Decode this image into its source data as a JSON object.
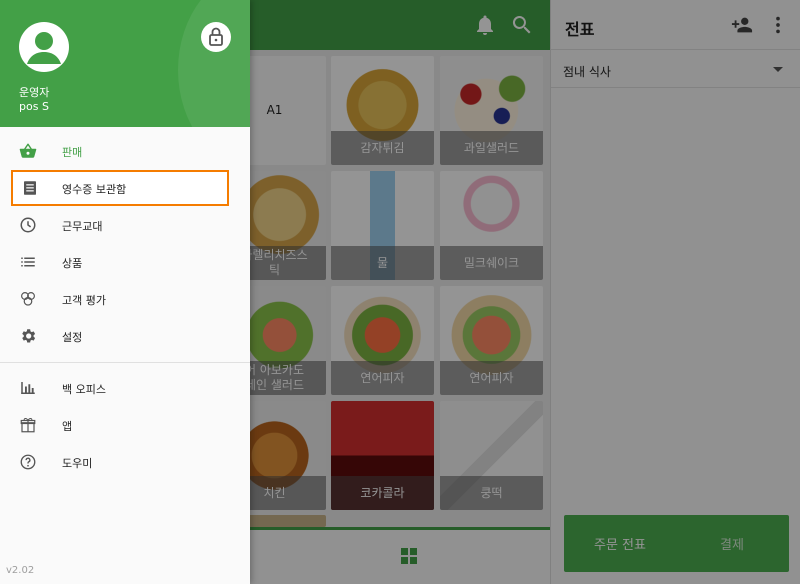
{
  "drawer": {
    "user_name": "운영자",
    "user_sub": "pos S",
    "menu": [
      {
        "label": "판매",
        "icon": "basket-icon",
        "active": true
      },
      {
        "label": "영수증 보관함",
        "icon": "receipt-icon",
        "selected": true
      },
      {
        "label": "근무교대",
        "icon": "clock-icon"
      },
      {
        "label": "상품",
        "icon": "list-icon"
      },
      {
        "label": "고객 평가",
        "icon": "feedback-icon"
      },
      {
        "label": "설정",
        "icon": "gear-icon"
      },
      {
        "label": "백 오피스",
        "icon": "bar-chart-icon"
      },
      {
        "label": "앱",
        "icon": "apps-icon"
      },
      {
        "label": "도우미",
        "icon": "help-icon"
      }
    ],
    "version": "v2.02"
  },
  "products": [
    {
      "label": "A1",
      "plain": true
    },
    {
      "label": "감자튀김"
    },
    {
      "label": "과일샐러드"
    },
    {
      "label": "파렐리치즈스틱",
      "visible_label": "​파렐리치즈스\n틱"
    },
    {
      "label": "물"
    },
    {
      "label": "밀크쉐이크"
    },
    {
      "label": "어 아보카도 레인 샐러드",
      "visible_label": "어 아보카도\n레인 샐러드"
    },
    {
      "label": "연어피자"
    },
    {
      "label": "연어피자"
    },
    {
      "label": "치킨"
    },
    {
      "label": "코카콜라"
    },
    {
      "label": "쿵떡"
    }
  ],
  "ticket": {
    "title": "전표",
    "order_type": "점내 식사",
    "btn_save": "주문 전표",
    "btn_pay": "결제"
  },
  "colors": {
    "primary": "#43a047",
    "highlight": "#f57c00"
  }
}
